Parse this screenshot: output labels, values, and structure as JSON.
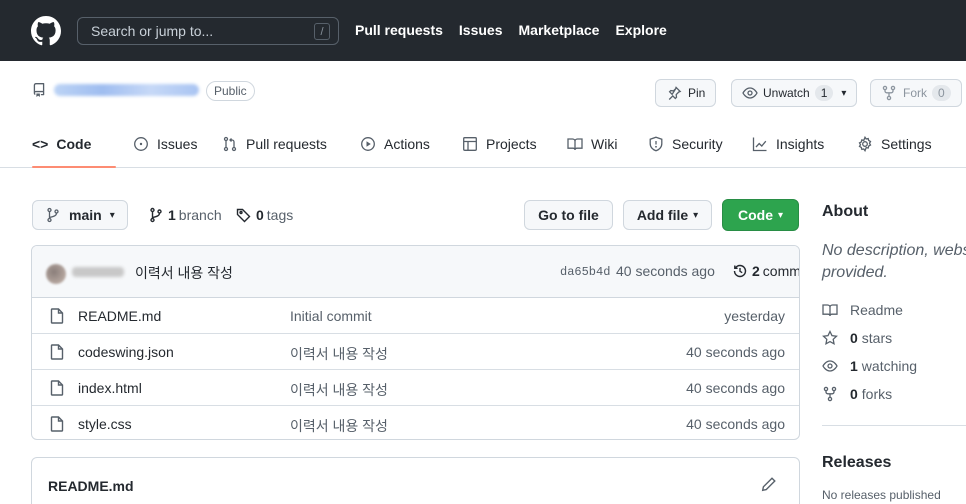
{
  "header": {
    "search_placeholder": "Search or jump to...",
    "search_shortcut": "/",
    "nav": [
      "Pull requests",
      "Issues",
      "Marketplace",
      "Explore"
    ]
  },
  "repo": {
    "visibility": "Public",
    "pin_label": "Pin",
    "watch_label": "Unwatch",
    "watch_count": "1",
    "fork_label": "Fork",
    "fork_count": "0"
  },
  "tabs": [
    {
      "label": "Code",
      "icon": "code-icon",
      "active": true
    },
    {
      "label": "Issues",
      "icon": "issue-icon"
    },
    {
      "label": "Pull requests",
      "icon": "pull-request-icon"
    },
    {
      "label": "Actions",
      "icon": "play-icon"
    },
    {
      "label": "Projects",
      "icon": "table-icon"
    },
    {
      "label": "Wiki",
      "icon": "book-icon"
    },
    {
      "label": "Security",
      "icon": "shield-icon"
    },
    {
      "label": "Insights",
      "icon": "graph-icon"
    },
    {
      "label": "Settings",
      "icon": "gear-icon"
    }
  ],
  "toolbar": {
    "branch": "main",
    "branch_count": "1",
    "branch_word": "branch",
    "tag_count": "0",
    "tag_word": "tags",
    "go_to_file": "Go to file",
    "add_file": "Add file",
    "code_button": "Code"
  },
  "commit": {
    "message": "이력서 내용 작성",
    "sha": "da65b4d",
    "time": "40 seconds ago",
    "count": "2",
    "count_word": "commits"
  },
  "files": [
    {
      "name": "README.md",
      "message": "Initial commit",
      "time": "yesterday"
    },
    {
      "name": "codeswing.json",
      "message": "이력서 내용 작성",
      "time": "40 seconds ago"
    },
    {
      "name": "index.html",
      "message": "이력서 내용 작성",
      "time": "40 seconds ago"
    },
    {
      "name": "style.css",
      "message": "이력서 내용 작성",
      "time": "40 seconds ago"
    }
  ],
  "readme": {
    "title": "README.md"
  },
  "sidebar": {
    "about_title": "About",
    "about_desc_1": "No description, webs",
    "about_desc_2": "provided.",
    "readme_label": "Readme",
    "stars_count": "0",
    "stars_word": "stars",
    "watching_count": "1",
    "watching_word": "watching",
    "forks_count": "0",
    "forks_word": "forks",
    "releases_title": "Releases",
    "releases_text": "No releases published"
  },
  "colors": {
    "header_bg": "#24292f",
    "code_button": "#2da44e",
    "active_tab_underline": "#fd8c73"
  }
}
